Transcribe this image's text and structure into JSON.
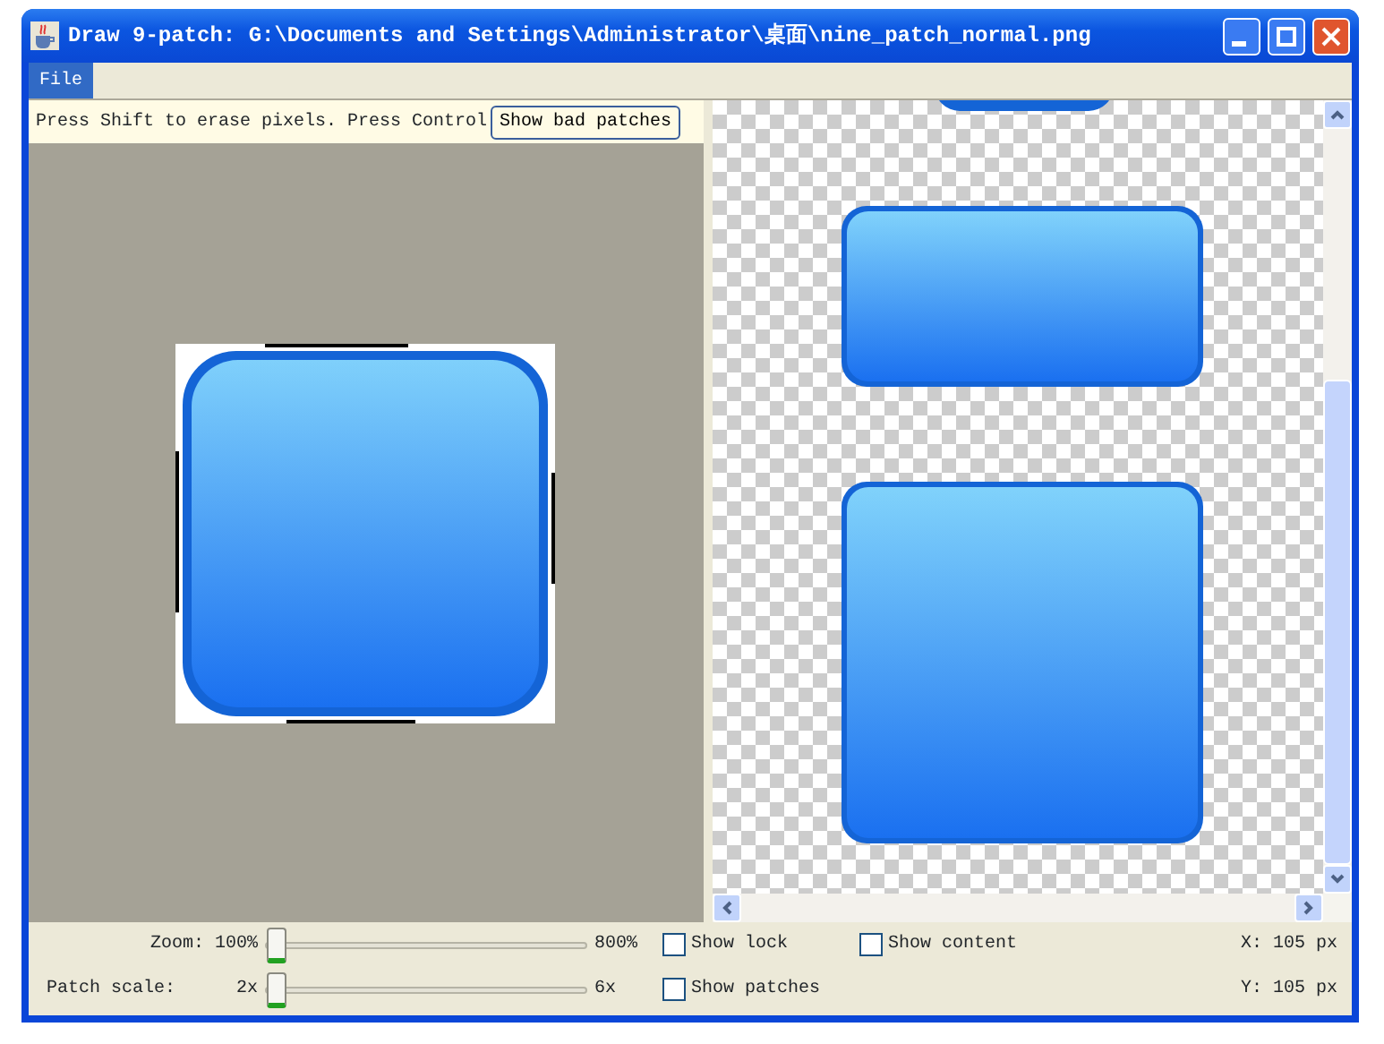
{
  "window": {
    "title": "Draw 9-patch: G:\\Documents and Settings\\Administrator\\桌面\\nine_patch_normal.png"
  },
  "menu": [
    {
      "label": "File",
      "selected": true
    }
  ],
  "editor": {
    "hint": "Press Shift to erase pixels. Press Control",
    "overlay_button": "Show bad patches"
  },
  "controls": {
    "zoom": {
      "label": "Zoom:",
      "min": "100%",
      "max": "800%",
      "level": 0
    },
    "patch_scale": {
      "label": "Patch scale:",
      "min": "2x",
      "max": "6x",
      "level": 0
    },
    "checkboxes": [
      {
        "label": "Show lock",
        "checked": false
      },
      {
        "label": "Show content",
        "checked": false
      },
      {
        "label": "Show patches",
        "checked": false
      }
    ],
    "x": "X: 105 px",
    "y": "Y: 105 px"
  }
}
